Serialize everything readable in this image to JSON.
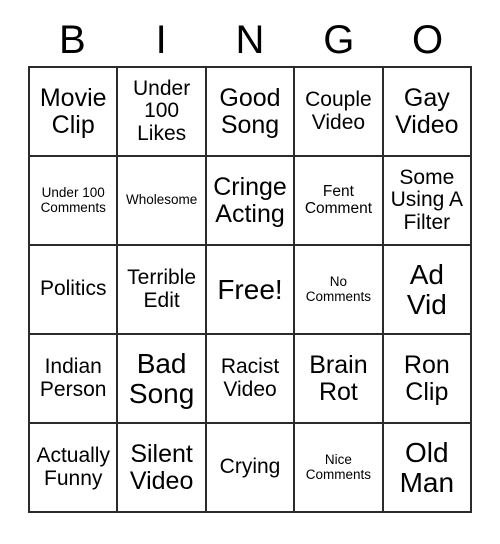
{
  "card": {
    "title": "BINGO",
    "headers": [
      "B",
      "I",
      "N",
      "G",
      "O"
    ],
    "rows": [
      [
        {
          "text": "Movie Clip",
          "size": "fs-lg"
        },
        {
          "text": "Under 100 Likes",
          "size": "fs-md"
        },
        {
          "text": "Good Song",
          "size": "fs-lg"
        },
        {
          "text": "Couple Video",
          "size": "fs-md"
        },
        {
          "text": "Gay Video",
          "size": "fs-lg"
        }
      ],
      [
        {
          "text": "Under 100 Comments",
          "size": "fs-xs"
        },
        {
          "text": "Wholesome",
          "size": "fs-xs"
        },
        {
          "text": "Cringe Acting",
          "size": "fs-lg"
        },
        {
          "text": "Fent Comment",
          "size": "fs-sm"
        },
        {
          "text": "Some Using A Filter",
          "size": "fs-md"
        }
      ],
      [
        {
          "text": "Politics",
          "size": "fs-md"
        },
        {
          "text": "Terrible Edit",
          "size": "fs-md"
        },
        {
          "text": "Free!",
          "size": "fs-xl"
        },
        {
          "text": "No Comments",
          "size": "fs-xs"
        },
        {
          "text": "Ad Vid",
          "size": "fs-xl"
        }
      ],
      [
        {
          "text": "Indian Person",
          "size": "fs-md"
        },
        {
          "text": "Bad Song",
          "size": "fs-xl"
        },
        {
          "text": "Racist Video",
          "size": "fs-md"
        },
        {
          "text": "Brain Rot",
          "size": "fs-lg"
        },
        {
          "text": "Ron Clip",
          "size": "fs-lg"
        }
      ],
      [
        {
          "text": "Actually Funny",
          "size": "fs-md"
        },
        {
          "text": "Silent Video",
          "size": "fs-lg"
        },
        {
          "text": "Crying",
          "size": "fs-md"
        },
        {
          "text": "Nice Comments",
          "size": "fs-xs"
        },
        {
          "text": "Old Man",
          "size": "fs-xl"
        }
      ]
    ],
    "free_space": "Free!",
    "colors": {
      "text": "#000000",
      "border": "#2b2b2b",
      "background": "#ffffff"
    }
  }
}
